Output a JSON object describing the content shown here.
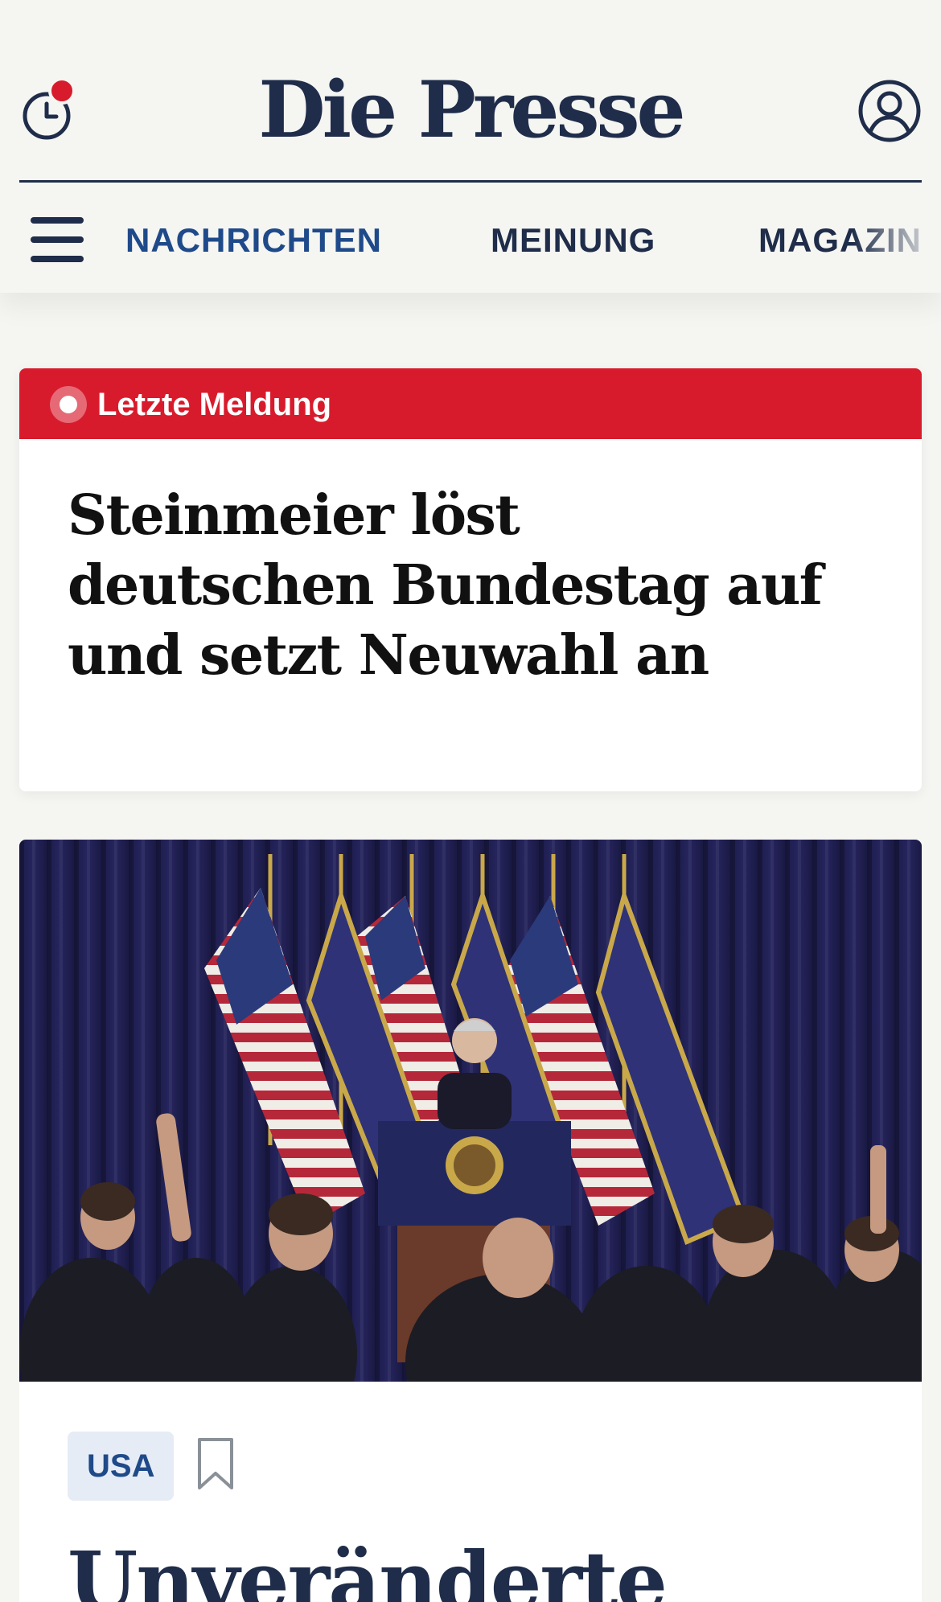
{
  "header": {
    "logo": "Die Presse"
  },
  "nav": {
    "items": [
      {
        "label": "NACHRICHTEN",
        "active": true
      },
      {
        "label": "MEINUNG",
        "active": false
      },
      {
        "label": "MAGAZIN",
        "active": false
      }
    ]
  },
  "breaking": {
    "label": "Letzte Meldung",
    "headline": "Steinmeier löst deutschen Bundestag auf und setzt Neuwahl an"
  },
  "article": {
    "tag": "USA",
    "headline": "Unveränderte"
  },
  "colors": {
    "brand_navy": "#1f2d4a",
    "active_nav": "#1f4a8a",
    "breaking_red": "#d81b2c",
    "background": "#f5f5f2"
  }
}
